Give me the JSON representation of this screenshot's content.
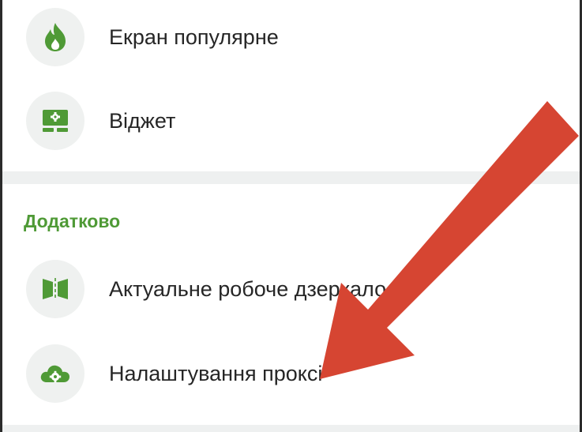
{
  "menu": {
    "items_top": [
      {
        "label": "Екран популярне",
        "icon": "flame-icon"
      },
      {
        "label": "Віджет",
        "icon": "widget-icon"
      }
    ],
    "section": {
      "title": "Додатково",
      "items": [
        {
          "label": "Актуальне робоче дзеркало",
          "icon": "mirror-icon"
        },
        {
          "label": "Налаштування проксі",
          "icon": "cloud-settings-icon"
        }
      ]
    }
  },
  "colors": {
    "accent": "#4f9a36",
    "arrow": "#d64532",
    "text": "#262626",
    "icon_bg": "#eff1f0"
  }
}
